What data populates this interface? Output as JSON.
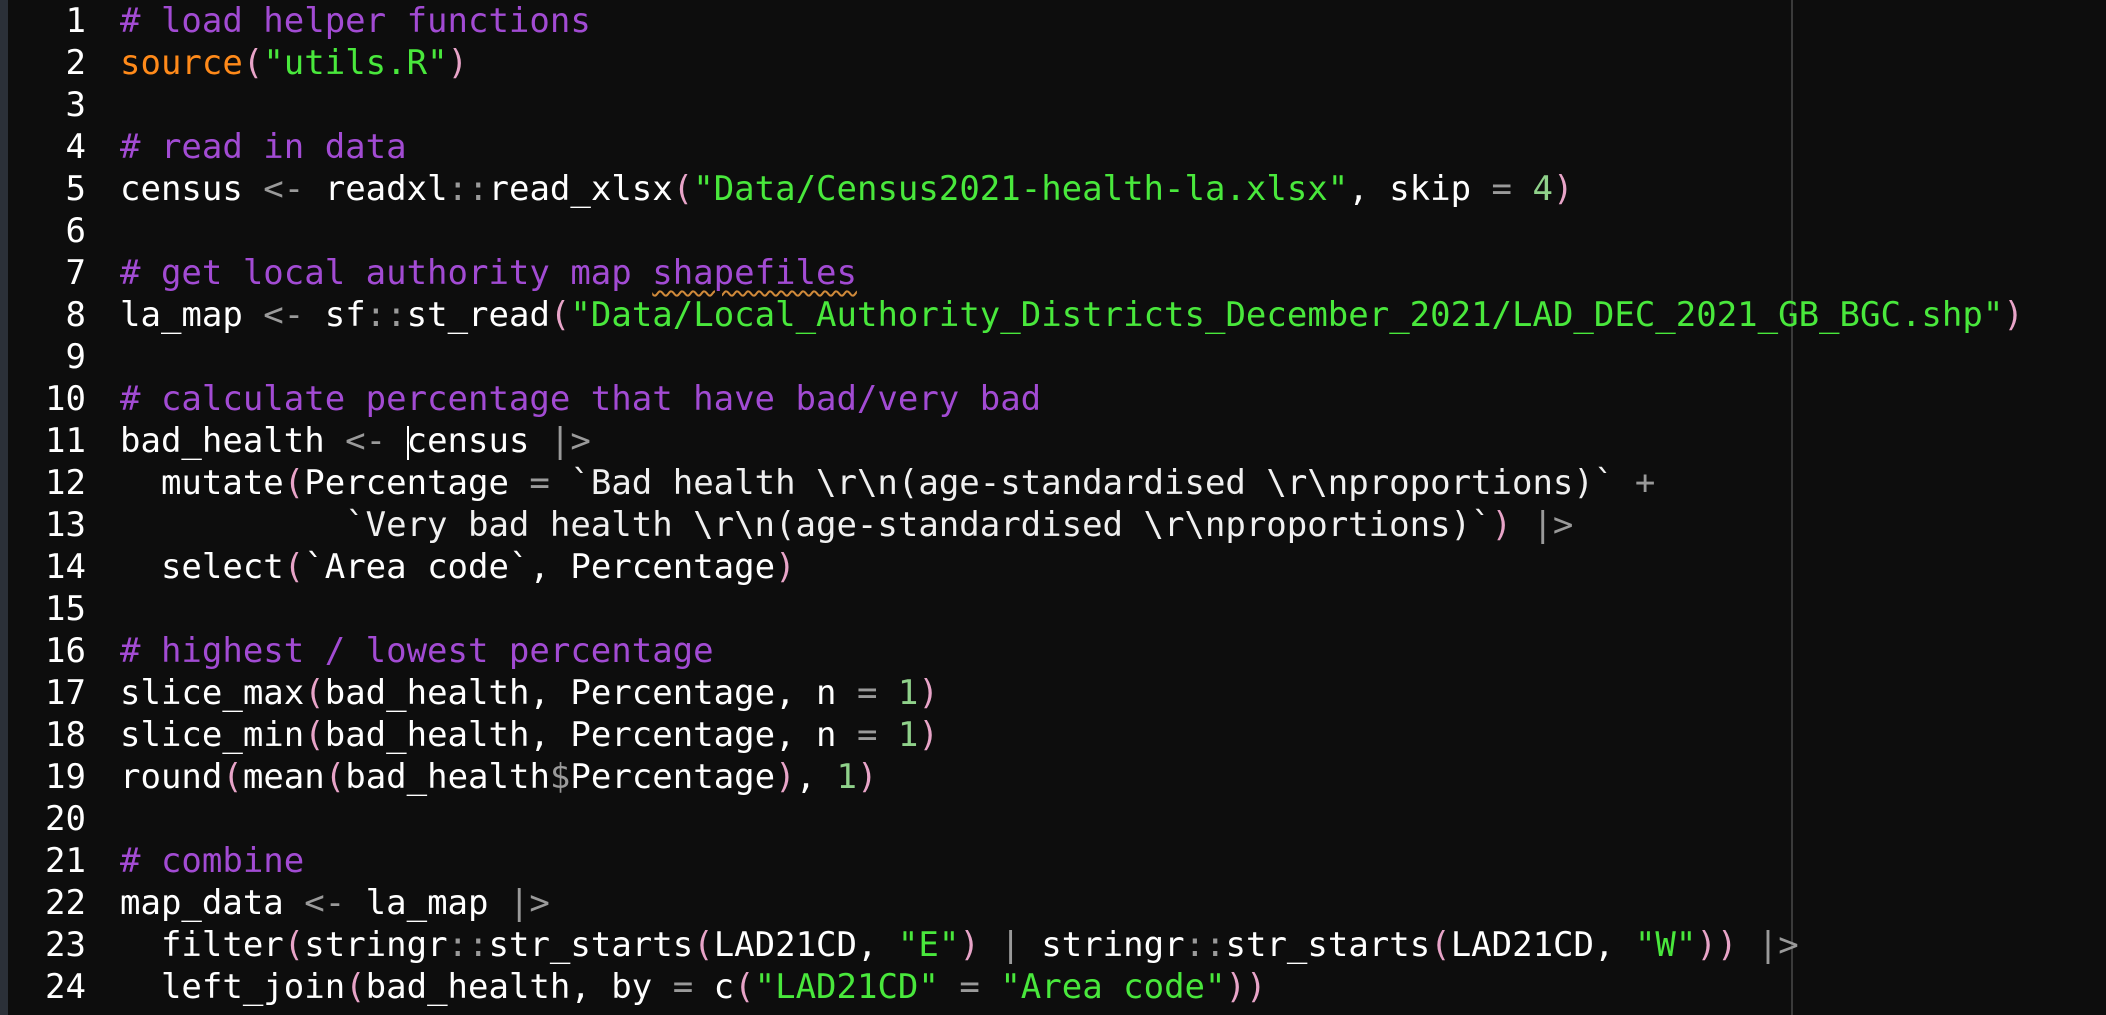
{
  "editor": {
    "lines": [
      {
        "n": "1",
        "text": "# load helper functions"
      },
      {
        "n": "2",
        "text": "source(\"utils.R\")"
      },
      {
        "n": "3",
        "text": ""
      },
      {
        "n": "4",
        "text": "# read in data"
      },
      {
        "n": "5",
        "text": "census <- readxl::read_xlsx(\"Data/Census2021-health-la.xlsx\", skip = 4)"
      },
      {
        "n": "6",
        "text": ""
      },
      {
        "n": "7",
        "text": "# get local authority map shapefiles"
      },
      {
        "n": "8",
        "text": "la_map <- sf::st_read(\"Data/Local_Authority_Districts_December_2021/LAD_DEC_2021_GB_BGC.shp\")"
      },
      {
        "n": "9",
        "text": ""
      },
      {
        "n": "10",
        "text": "# calculate percentage that have bad/very bad"
      },
      {
        "n": "11",
        "text": "bad_health <- census |>"
      },
      {
        "n": "12",
        "text": "  mutate(Percentage = `Bad health \\r\\n(age-standardised \\r\\nproportions)` +"
      },
      {
        "n": "13",
        "text": "           `Very bad health \\r\\n(age-standardised \\r\\nproportions)`) |>"
      },
      {
        "n": "14",
        "text": "  select(`Area code`, Percentage)"
      },
      {
        "n": "15",
        "text": ""
      },
      {
        "n": "16",
        "text": "# highest / lowest percentage"
      },
      {
        "n": "17",
        "text": "slice_max(bad_health, Percentage, n = 1)"
      },
      {
        "n": "18",
        "text": "slice_min(bad_health, Percentage, n = 1)"
      },
      {
        "n": "19",
        "text": "round(mean(bad_health$Percentage), 1)"
      },
      {
        "n": "20",
        "text": ""
      },
      {
        "n": "21",
        "text": "# combine"
      },
      {
        "n": "22",
        "text": "map_data <- la_map |>"
      },
      {
        "n": "23",
        "text": "  filter(stringr::str_starts(LAD21CD, \"E\") | stringr::str_starts(LAD21CD, \"W\")) |>"
      },
      {
        "n": "24",
        "text": "  left_join(bad_health, by = c(\"LAD21CD\" = \"Area code\"))"
      }
    ],
    "tokens": {
      "l1": "# load helper functions",
      "l2_fn": "source",
      "l2_str": "\"utils.R\"",
      "l4": "# read in data",
      "l5_a": "census ",
      "l5_op": "<-",
      "l5_b": " readxl",
      "l5_ns": "::",
      "l5_c": "read_xlsx",
      "l5_str": "\"Data/Census2021-health-la.xlsx\"",
      "l5_d": ", skip ",
      "l5_eq": "=",
      "l5_num": "4",
      "l7_a": "# get local authority map ",
      "l7_b": "shapefiles",
      "l8_a": "la_map ",
      "l8_op": "<-",
      "l8_b": " sf",
      "l8_ns": "::",
      "l8_c": "st_read",
      "l8_str": "\"Data/Local_Authority_Districts_December_2021/LAD_DEC_2021_GB_BGC.shp\"",
      "l10": "# calculate percentage that have bad/very bad",
      "l11_a": "bad_health ",
      "l11_op": "<-",
      "l11_b": "census ",
      "l11_pipe": "|>",
      "l12_a": "  mutate",
      "l12_b": "Percentage ",
      "l12_eq": "=",
      "l12_c": " `Bad health \\r\\n(age-standardised \\r\\nproportions)` ",
      "l12_plus": "+",
      "l13_a": "           `Very bad health \\r\\n(age-standardised \\r\\nproportions)`",
      "l13_pipe": "|>",
      "l14_a": "  select",
      "l14_b": "`Area code`, Percentage",
      "l16": "# highest / lowest percentage",
      "l17_a": "slice_max",
      "l17_b": "bad_health, Percentage, n ",
      "l17_eq": "=",
      "l17_num": "1",
      "l18_a": "slice_min",
      "l18_b": "bad_health, Percentage, n ",
      "l18_eq": "=",
      "l18_num": "1",
      "l19_a": "round",
      "l19_b": "mean",
      "l19_c": "bad_health",
      "l19_dollar": "$",
      "l19_d": "Percentage",
      "l19_e": ", ",
      "l19_num": "1",
      "l21": "# combine",
      "l22_a": "map_data ",
      "l22_op": "<-",
      "l22_b": " la_map ",
      "l22_pipe": "|>",
      "l23_a": "  filter",
      "l23_b": "stringr",
      "l23_ns": "::",
      "l23_c": "str_starts",
      "l23_d": "LAD21CD, ",
      "l23_s1": "\"E\"",
      "l23_or": "|",
      "l23_e": " stringr",
      "l23_ns2": "::",
      "l23_f": "str_starts",
      "l23_g": "LAD21CD, ",
      "l23_s2": "\"W\"",
      "l23_pipe": "|>",
      "l24_a": "  left_join",
      "l24_b": "bad_health, by ",
      "l24_eq": "=",
      "l24_c": " c",
      "l24_s1": "\"LAD21CD\"",
      "l24_eq2": "=",
      "l24_s2": "\"Area code\""
    }
  },
  "colors": {
    "background": "#0d0d0d",
    "comment": "#a24bd3",
    "string": "#49e83c",
    "number": "#8fd18a",
    "source_fn": "#ff8a1a",
    "operator": "#9a9a9a",
    "paren": "#e8a4c8"
  }
}
